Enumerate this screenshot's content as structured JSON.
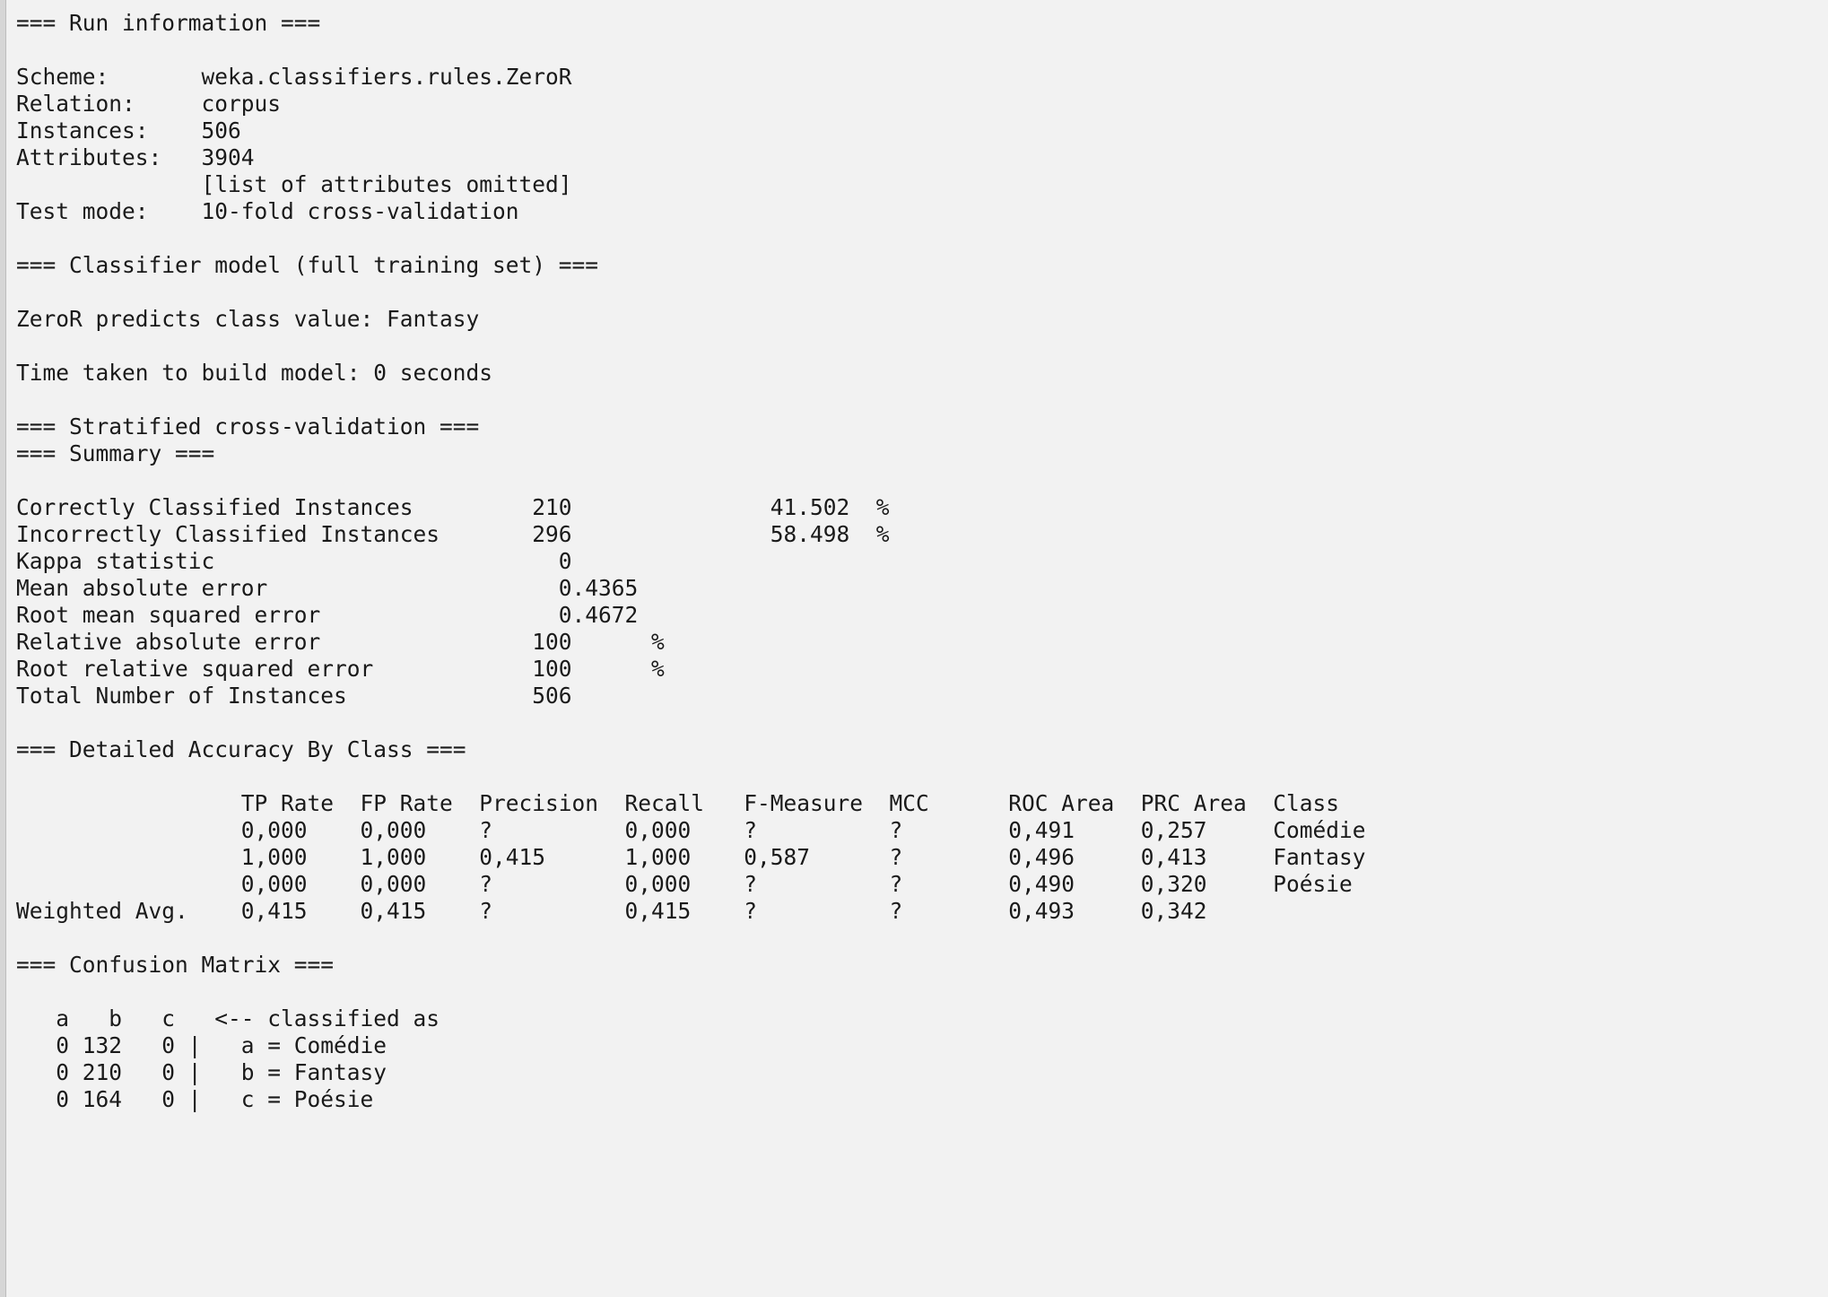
{
  "output": {
    "lines": [
      "=== Run information ===",
      "",
      "Scheme:       weka.classifiers.rules.ZeroR",
      "Relation:     corpus",
      "Instances:    506",
      "Attributes:   3904",
      "              [list of attributes omitted]",
      "Test mode:    10-fold cross-validation",
      "",
      "=== Classifier model (full training set) ===",
      "",
      "ZeroR predicts class value: Fantasy",
      "",
      "Time taken to build model: 0 seconds",
      "",
      "=== Stratified cross-validation ===",
      "=== Summary ===",
      "",
      "Correctly Classified Instances         210               41.502  %",
      "Incorrectly Classified Instances       296               58.498  %",
      "Kappa statistic                          0",
      "Mean absolute error                      0.4365",
      "Root mean squared error                  0.4672",
      "Relative absolute error                100      %",
      "Root relative squared error            100      %",
      "Total Number of Instances              506",
      "",
      "=== Detailed Accuracy By Class ===",
      "",
      "                 TP Rate  FP Rate  Precision  Recall   F-Measure  MCC      ROC Area  PRC Area  Class",
      "                 0,000    0,000    ?          0,000    ?          ?        0,491     0,257     Comédie",
      "                 1,000    1,000    0,415      1,000    0,587      ?        0,496     0,413     Fantasy",
      "                 0,000    0,000    ?          0,000    ?          ?        0,490     0,320     Poésie",
      "Weighted Avg.    0,415    0,415    ?          0,415    ?          ?        0,493     0,342",
      "",
      "=== Confusion Matrix ===",
      "",
      "   a   b   c   <-- classified as",
      "   0 132   0 |   a = Comédie",
      "   0 210   0 |   b = Fantasy",
      "   0 164   0 |   c = Poésie"
    ]
  }
}
